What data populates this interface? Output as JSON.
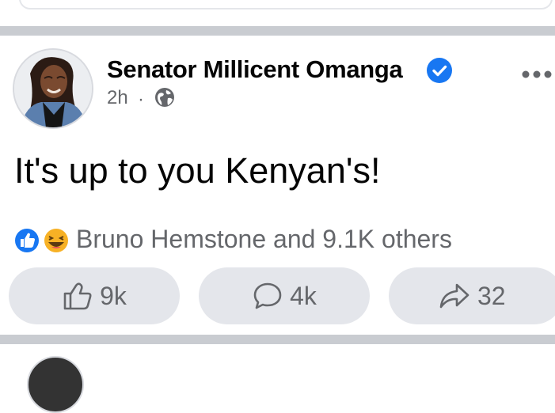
{
  "post": {
    "author": "Senator Millicent Omanga",
    "time": "2h",
    "separator": "·",
    "text": "It's up to you Kenyan's!",
    "reactions_summary": "Bruno Hemstone and 9.1K others",
    "reaction_icons": [
      "like-reaction-icon",
      "haha-reaction-icon"
    ]
  },
  "actions": {
    "like_count": "9k",
    "comment_count": "4k",
    "share_count": "32"
  },
  "colors": {
    "like_blue": "#1877f2",
    "verified_blue": "#1877f2",
    "separator_gray": "#c9ccd1",
    "button_bg": "#e4e6eb",
    "secondary_text": "#65676b"
  }
}
